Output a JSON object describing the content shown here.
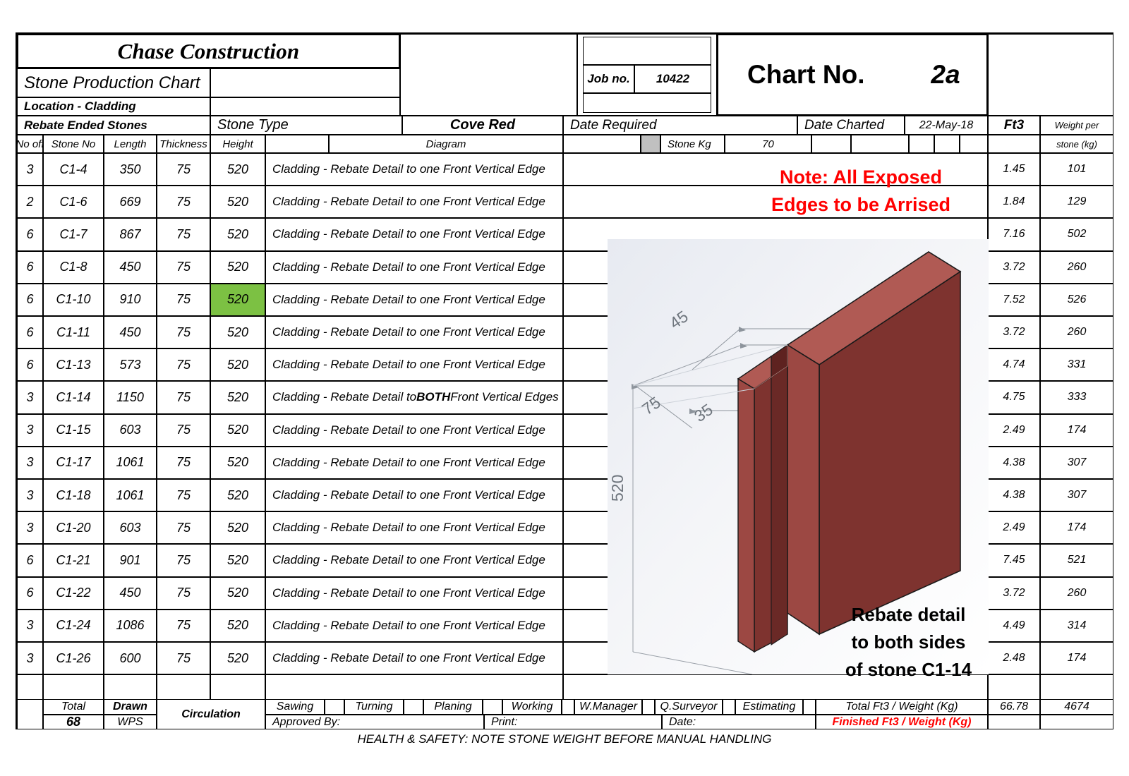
{
  "header": {
    "company": "Chase Construction",
    "doc_title": "Stone Production Chart",
    "location": "Location - Cladding",
    "subtitle": "Rebate Ended Stones",
    "job_no_label": "Job no.",
    "job_no_value": "10422",
    "chart_no_label": "Chart No.",
    "chart_no_value": "2a",
    "stone_type_label": "Stone Type",
    "stone_type_value": "Cove Red",
    "date_required_label": "Date Required",
    "date_required_value": "",
    "date_charted_label": "Date Charted",
    "date_charted_value": "22-May-18",
    "ft3_label": "Ft3",
    "weight_label_1": "Weight per",
    "weight_label_2": "stone (kg)",
    "stone_kg_label": "Stone Kg",
    "stone_kg_value": "70"
  },
  "columns": {
    "no_off": "No off",
    "stone_no": "Stone No",
    "length": "Length",
    "thickness": "Thickness",
    "height": "Height",
    "diagram": "Diagram"
  },
  "rows": [
    {
      "no_off": "3",
      "stone_no": "C1-4",
      "length": "350",
      "thickness": "75",
      "height": "520",
      "desc_pre": "Cladding - Rebate Detail to one Front Vertical Edge",
      "desc_bold": "",
      "desc_post": "",
      "ft3": "1.45",
      "weight": "101",
      "highlight": false
    },
    {
      "no_off": "2",
      "stone_no": "C1-6",
      "length": "669",
      "thickness": "75",
      "height": "520",
      "desc_pre": "Cladding - Rebate Detail to one Front Vertical Edge",
      "desc_bold": "",
      "desc_post": "",
      "ft3": "1.84",
      "weight": "129",
      "highlight": false
    },
    {
      "no_off": "6",
      "stone_no": "C1-7",
      "length": "867",
      "thickness": "75",
      "height": "520",
      "desc_pre": "Cladding - Rebate Detail to one Front Vertical Edge",
      "desc_bold": "",
      "desc_post": "",
      "ft3": "7.16",
      "weight": "502",
      "highlight": false
    },
    {
      "no_off": "6",
      "stone_no": "C1-8",
      "length": "450",
      "thickness": "75",
      "height": "520",
      "desc_pre": "Cladding - Rebate Detail to one Front Vertical Edge",
      "desc_bold": "",
      "desc_post": "",
      "ft3": "3.72",
      "weight": "260",
      "highlight": false
    },
    {
      "no_off": "6",
      "stone_no": "C1-10",
      "length": "910",
      "thickness": "75",
      "height": "520",
      "desc_pre": "Cladding - Rebate Detail to one Front Vertical Edge",
      "desc_bold": "",
      "desc_post": "",
      "ft3": "7.52",
      "weight": "526",
      "highlight": true
    },
    {
      "no_off": "6",
      "stone_no": "C1-11",
      "length": "450",
      "thickness": "75",
      "height": "520",
      "desc_pre": "Cladding - Rebate Detail to one Front Vertical Edge",
      "desc_bold": "",
      "desc_post": "",
      "ft3": "3.72",
      "weight": "260",
      "highlight": false
    },
    {
      "no_off": "6",
      "stone_no": "C1-13",
      "length": "573",
      "thickness": "75",
      "height": "520",
      "desc_pre": "Cladding - Rebate Detail to one Front Vertical Edge",
      "desc_bold": "",
      "desc_post": "",
      "ft3": "4.74",
      "weight": "331",
      "highlight": false
    },
    {
      "no_off": "3",
      "stone_no": "C1-14",
      "length": "1150",
      "thickness": "75",
      "height": "520",
      "desc_pre": "Cladding - Rebate Detail to ",
      "desc_bold": "BOTH",
      "desc_post": " Front Vertical Edges",
      "ft3": "4.75",
      "weight": "333",
      "highlight": false
    },
    {
      "no_off": "3",
      "stone_no": "C1-15",
      "length": "603",
      "thickness": "75",
      "height": "520",
      "desc_pre": "Cladding - Rebate Detail to one Front Vertical Edge",
      "desc_bold": "",
      "desc_post": "",
      "ft3": "2.49",
      "weight": "174",
      "highlight": false
    },
    {
      "no_off": "3",
      "stone_no": "C1-17",
      "length": "1061",
      "thickness": "75",
      "height": "520",
      "desc_pre": "Cladding - Rebate Detail to one Front Vertical Edge",
      "desc_bold": "",
      "desc_post": "",
      "ft3": "4.38",
      "weight": "307",
      "highlight": false
    },
    {
      "no_off": "3",
      "stone_no": "C1-18",
      "length": "1061",
      "thickness": "75",
      "height": "520",
      "desc_pre": "Cladding - Rebate Detail to one Front Vertical Edge",
      "desc_bold": "",
      "desc_post": "",
      "ft3": "4.38",
      "weight": "307",
      "highlight": false
    },
    {
      "no_off": "3",
      "stone_no": "C1-20",
      "length": "603",
      "thickness": "75",
      "height": "520",
      "desc_pre": "Cladding - Rebate Detail to one Front Vertical Edge",
      "desc_bold": "",
      "desc_post": "",
      "ft3": "2.49",
      "weight": "174",
      "highlight": false
    },
    {
      "no_off": "6",
      "stone_no": "C1-21",
      "length": "901",
      "thickness": "75",
      "height": "520",
      "desc_pre": "Cladding - Rebate Detail to one Front Vertical Edge",
      "desc_bold": "",
      "desc_post": "",
      "ft3": "7.45",
      "weight": "521",
      "highlight": false
    },
    {
      "no_off": "6",
      "stone_no": "C1-22",
      "length": "450",
      "thickness": "75",
      "height": "520",
      "desc_pre": "Cladding - Rebate Detail to one Front Vertical Edge",
      "desc_bold": "",
      "desc_post": "",
      "ft3": "3.72",
      "weight": "260",
      "highlight": false
    },
    {
      "no_off": "3",
      "stone_no": "C1-24",
      "length": "1086",
      "thickness": "75",
      "height": "520",
      "desc_pre": "Cladding - Rebate Detail to one Front Vertical Edge",
      "desc_bold": "",
      "desc_post": "",
      "ft3": "4.49",
      "weight": "314",
      "highlight": false
    },
    {
      "no_off": "3",
      "stone_no": "C1-26",
      "length": "600",
      "thickness": "75",
      "height": "520",
      "desc_pre": "Cladding - Rebate Detail to one Front Vertical Edge",
      "desc_bold": "",
      "desc_post": "",
      "ft3": "2.48",
      "weight": "174",
      "highlight": false
    },
    {
      "no_off": "",
      "stone_no": "",
      "length": "",
      "thickness": "",
      "height": "",
      "desc_pre": "",
      "desc_bold": "",
      "desc_post": "",
      "ft3": "",
      "weight": "",
      "highlight": false
    }
  ],
  "diagram": {
    "note_line1": "Note: All Exposed",
    "note_line2": "Edges to be Arrised",
    "caption_line1": "Rebate detail",
    "caption_line2": "to both sides",
    "caption_line3": "of stone C1-14",
    "dim_45": "45",
    "dim_75": "75",
    "dim_35": "35",
    "dim_520": "520",
    "stone_color": "#8b3a36",
    "stone_face_color": "#b05a54"
  },
  "footer": {
    "total_label": "Total",
    "total_value": "68",
    "drawn_label": "Drawn",
    "drawn_value": "WPS",
    "circulation_label": "Circulation",
    "sawing": "Sawing",
    "turning": "Turning",
    "planing": "Planing",
    "working": "Working",
    "w_manager": "W.Manager",
    "q_surveyor": "Q.Surveyor",
    "estimating": "Estimating",
    "total_ft3_label": "Total Ft3 / Weight (Kg)",
    "total_ft3_value": "66.78",
    "total_weight_value": "4674",
    "finished_label": "Finished Ft3 / Weight (Kg)",
    "finished_ft3_value": "",
    "finished_weight_value": "",
    "approved_by": "Approved By:",
    "print": "Print:",
    "date": "Date:",
    "safety": "HEALTH & SAFETY: NOTE STONE WEIGHT BEFORE MANUAL HANDLING"
  }
}
